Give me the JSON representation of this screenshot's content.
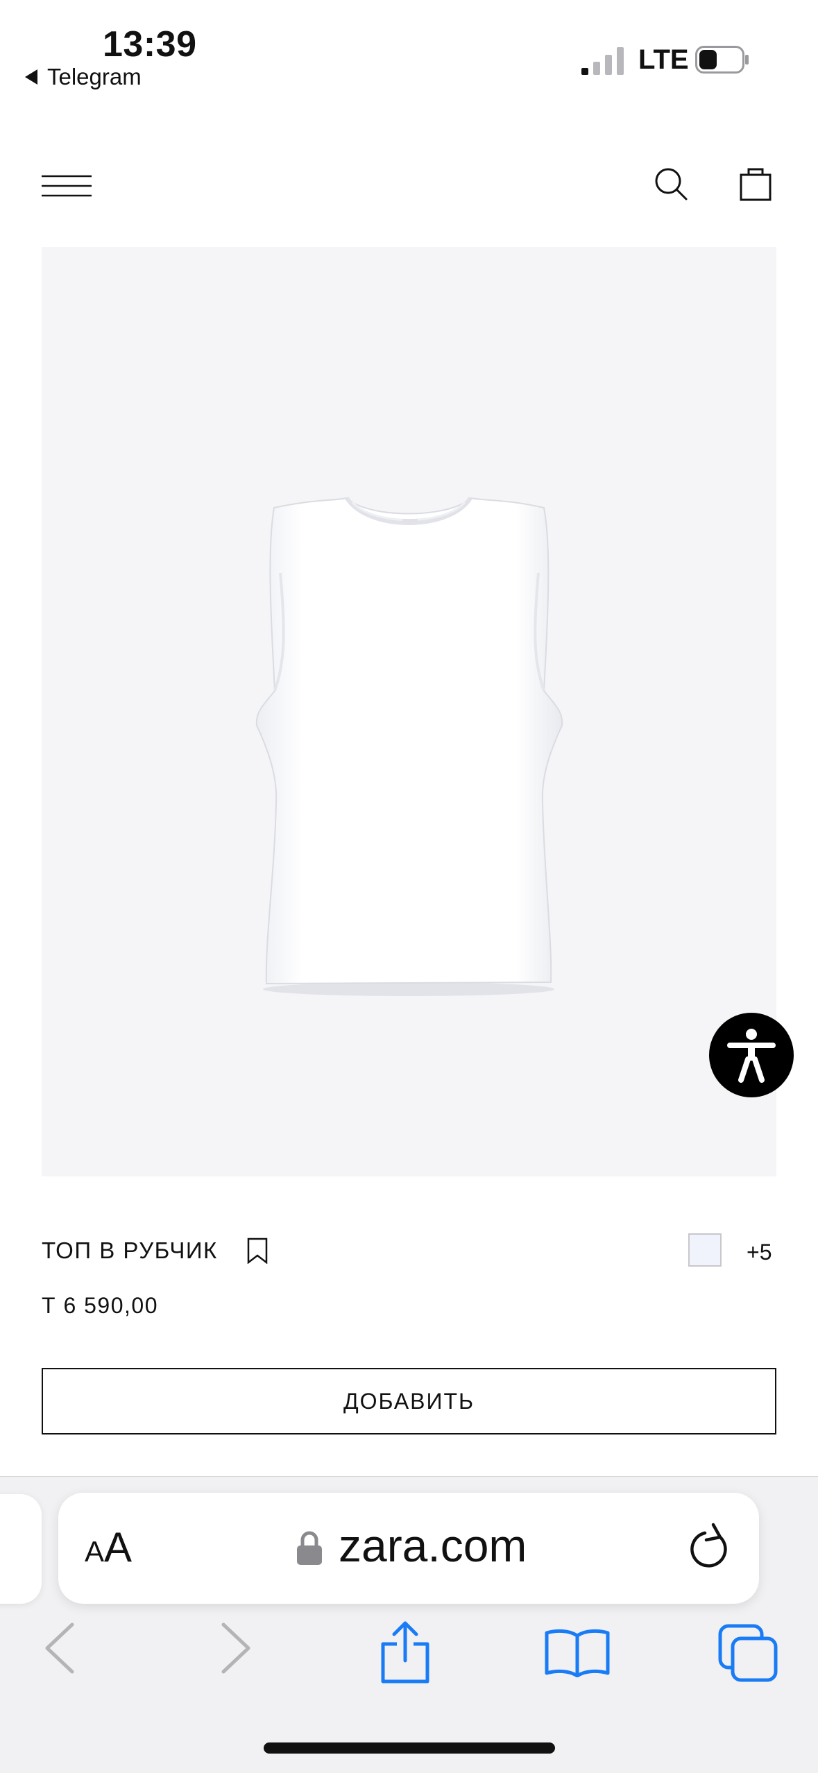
{
  "status_bar": {
    "time": "13:39",
    "back_app": "Telegram",
    "network": "LTE"
  },
  "header": {
    "menu_icon": "hamburger-menu-icon",
    "search_icon": "search-icon",
    "bag_icon": "shopping-bag-icon"
  },
  "product": {
    "name": "ТОП В РУБЧИК",
    "price": "Т 6 590,00",
    "more_colors": "+5",
    "swatch_color": "#f0f3fb",
    "image_background": "#f5f5f7",
    "add_button_label": "ДОБАВИТЬ"
  },
  "browser": {
    "text_size_label": "AA",
    "url": "zara.com",
    "accent_color": "#1a7cf5"
  }
}
